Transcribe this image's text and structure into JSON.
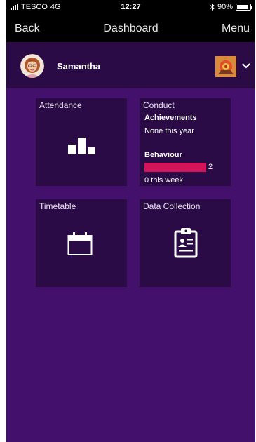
{
  "status_bar": {
    "carrier": "TESCO",
    "network": "4G",
    "time": "12:27",
    "bluetooth_icon": "bluetooth-icon",
    "battery_text": "90%",
    "battery_level": 0.9
  },
  "nav": {
    "back_label": "Back",
    "title": "Dashboard",
    "menu_label": "Menu"
  },
  "user": {
    "name": "Samantha",
    "avatar_icon": "student-avatar",
    "school_icon": "school-crest-icon",
    "switch_icon": "chevron-down-icon"
  },
  "tiles": {
    "attendance": {
      "title": "Attendance",
      "icon": "bar-chart-icon"
    },
    "conduct": {
      "title": "Conduct",
      "achievements_label": "Achievements",
      "achievements_value": "None this year",
      "behaviour_label": "Behaviour",
      "behaviour_count": "2",
      "behaviour_week": "0 this week"
    },
    "timetable": {
      "title": "Timetable",
      "icon": "calendar-icon"
    },
    "data_collection": {
      "title": "Data Collection",
      "icon": "clipboard-icon"
    }
  },
  "colors": {
    "background": "#43106b",
    "tile": "#2b0b45",
    "header": "#000000",
    "behaviour_bar": "#d4145a"
  }
}
